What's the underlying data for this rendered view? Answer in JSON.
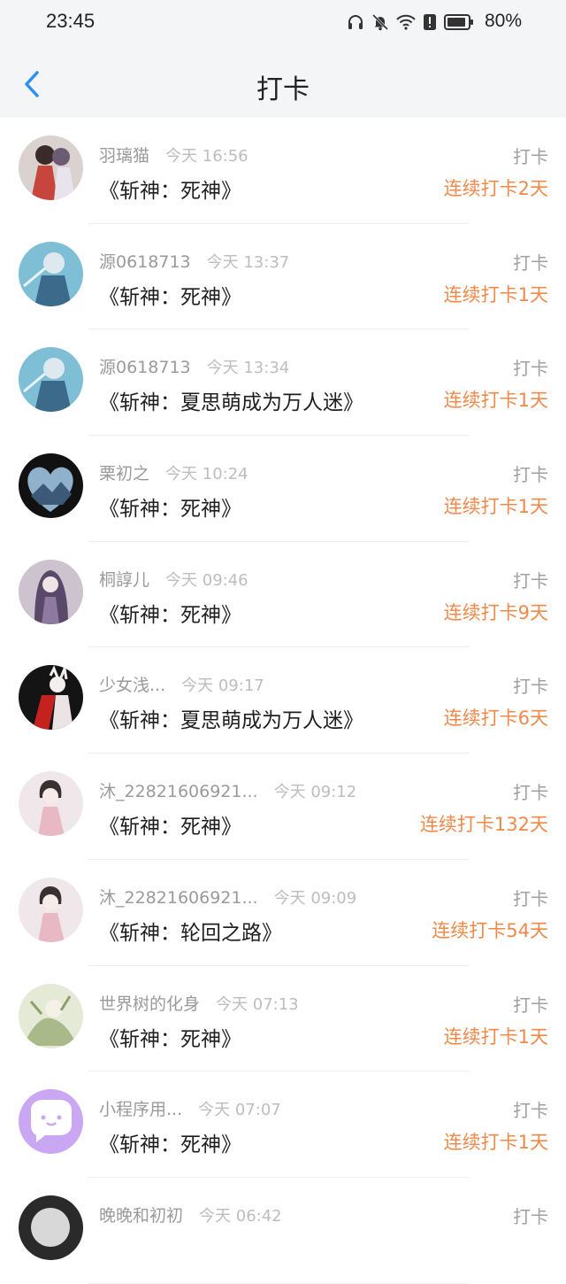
{
  "status_bar": {
    "time": "23:45",
    "battery": "80%"
  },
  "header": {
    "title": "打卡"
  },
  "items": [
    {
      "name": "羽璃猫",
      "time": "今天 16:56",
      "book": "《斩神：死神》",
      "action": "打卡",
      "streak": "连续打卡2天"
    },
    {
      "name": "源0618713",
      "time": "今天 13:37",
      "book": "《斩神：死神》",
      "action": "打卡",
      "streak": "连续打卡1天"
    },
    {
      "name": "源0618713",
      "time": "今天 13:34",
      "book": "《斩神：夏思萌成为万人迷》",
      "action": "打卡",
      "streak": "连续打卡1天"
    },
    {
      "name": "栗初之",
      "time": "今天 10:24",
      "book": "《斩神：死神》",
      "action": "打卡",
      "streak": "连续打卡1天"
    },
    {
      "name": "桐諄儿",
      "time": "今天 09:46",
      "book": "《斩神：死神》",
      "action": "打卡",
      "streak": "连续打卡9天"
    },
    {
      "name": "少女浅...",
      "time": "今天 09:17",
      "book": "《斩神：夏思萌成为万人迷》",
      "action": "打卡",
      "streak": "连续打卡6天"
    },
    {
      "name": "沐_22821606921...",
      "time": "今天 09:12",
      "book": "《斩神：死神》",
      "action": "打卡",
      "streak": "连续打卡132天"
    },
    {
      "name": "沐_22821606921...",
      "time": "今天 09:09",
      "book": "《斩神：轮回之路》",
      "action": "打卡",
      "streak": "连续打卡54天"
    },
    {
      "name": "世界树的化身",
      "time": "今天 07:13",
      "book": "《斩神：死神》",
      "action": "打卡",
      "streak": "连续打卡1天"
    },
    {
      "name": "小程序用...",
      "time": "今天 07:07",
      "book": "《斩神：死神》",
      "action": "打卡",
      "streak": "连续打卡1天"
    },
    {
      "name": "晚晚和初初",
      "time": "今天 06:42",
      "book": "",
      "action": "打卡",
      "streak": ""
    }
  ],
  "colors": {
    "accent": "#2e8ff0",
    "streak": "#f0894a"
  },
  "icons": [
    "chevron-left-icon",
    "headphones-icon",
    "bell-off-icon",
    "wifi-icon",
    "alert-icon",
    "battery-icon"
  ]
}
